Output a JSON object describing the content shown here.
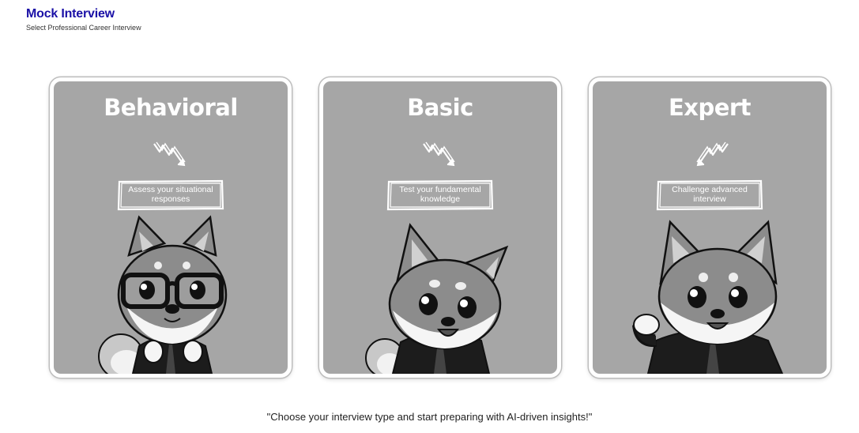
{
  "header": {
    "title": "Mock Interview",
    "subtitle": "Select Professional Career Interview"
  },
  "cards": [
    {
      "title": "Behavioral",
      "tagline": "Assess your situational responses",
      "icon": "shiba-glasses-icon"
    },
    {
      "title": "Basic",
      "tagline": "Test your fundamental knowledge",
      "icon": "shiba-smile-icon"
    },
    {
      "title": "Expert",
      "tagline": "Challenge advanced interview",
      "icon": "shiba-wave-icon"
    }
  ],
  "footer": {
    "tagline": "\"Choose your interview type and start preparing with AI-driven insights!\""
  },
  "colors": {
    "title": "#1a10a6",
    "card_bg": "#a6a6a6",
    "card_border": "#ffffff"
  }
}
